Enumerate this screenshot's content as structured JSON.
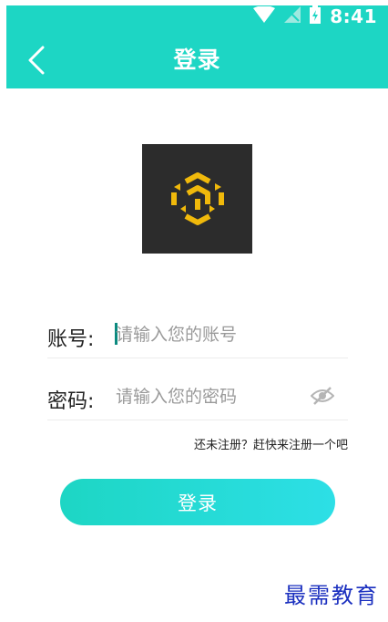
{
  "status_bar": {
    "time": "8:41"
  },
  "header": {
    "title": "登录",
    "back_icon": "chevron-left-icon"
  },
  "logo": {
    "icon": "cube-logo-icon",
    "background": "#2c2c2c",
    "accent": "#f0b90b"
  },
  "form": {
    "account": {
      "label": "账号:",
      "placeholder": "请输入您的账号",
      "value": ""
    },
    "password": {
      "label": "密码:",
      "placeholder": "请输入您的密码",
      "value": "",
      "visibility_icon": "eye-off-icon"
    }
  },
  "register_link": "还未注册？赶快来注册一个吧",
  "login_button": "登录",
  "watermark": "最需教育",
  "colors": {
    "primary": "#1dd6c4",
    "primary_end": "#2ddfe6",
    "text": "#222222",
    "placeholder": "#9a9a9a"
  }
}
